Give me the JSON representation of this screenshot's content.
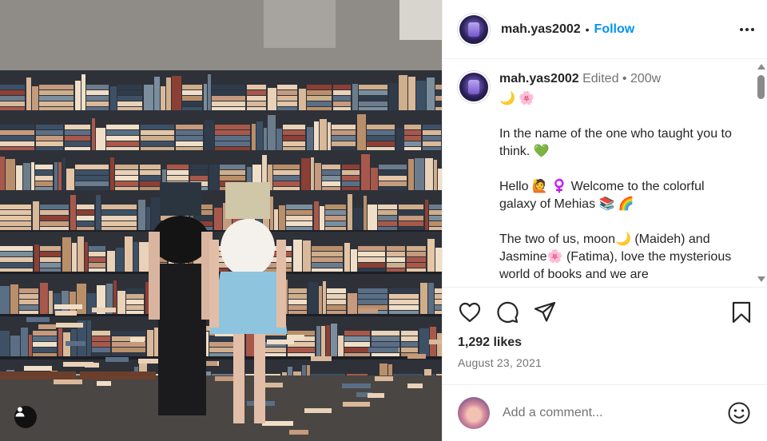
{
  "post": {
    "username": "mah.yas2002",
    "follow_label": "Follow",
    "dot": "•"
  },
  "caption": {
    "username": "mah.yas2002",
    "meta": "Edited • 200w",
    "text": "🌙 🌸\n\nIn the name of the one who taught you to think. 💚\n\nHello 🙋 ♀️ Welcome to the colorful galaxy of Mehias 📚 🌈\n\nThe two of us, moon🌙 (Maideh) and Jasmine🌸 (Fatima), love the mysterious world of books and we are"
  },
  "engagement": {
    "likes": "1,292 likes",
    "date": "August 23, 2021"
  },
  "comment": {
    "placeholder": "Add a comment..."
  },
  "icons": {
    "like": "heart-icon",
    "comment": "comment-icon",
    "share": "share-icon",
    "save": "bookmark-icon",
    "more": "more-icon",
    "emoji": "emoji-icon",
    "tag": "user-tag-icon"
  },
  "colors": {
    "accent": "#0095f6",
    "text": "#262626",
    "secondary": "#737373"
  }
}
